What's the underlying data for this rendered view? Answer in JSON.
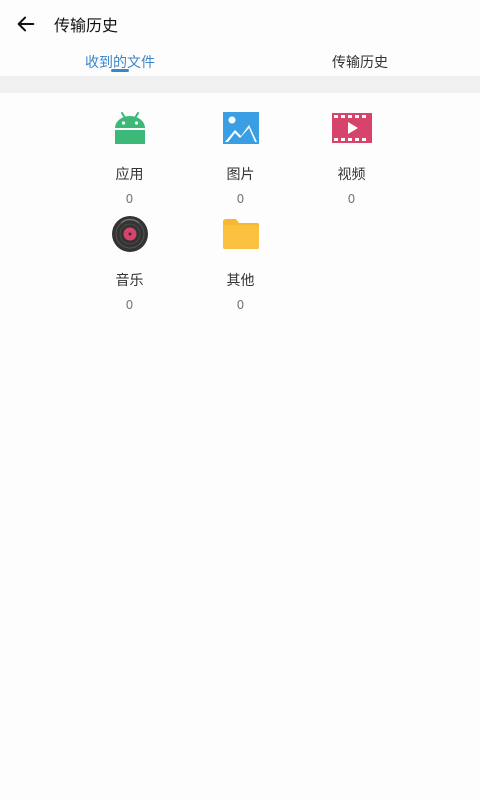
{
  "header": {
    "title": "传输历史"
  },
  "tabs": [
    {
      "label": "收到的文件",
      "active": true
    },
    {
      "label": "传输历史",
      "active": false
    }
  ],
  "categories": [
    {
      "label": "应用",
      "count": "0",
      "icon": "android-icon",
      "color": "#3cb878"
    },
    {
      "label": "图片",
      "count": "0",
      "icon": "image-icon",
      "color": "#3a9ee4"
    },
    {
      "label": "视频",
      "count": "0",
      "icon": "video-icon",
      "color": "#d6446b"
    },
    {
      "label": "音乐",
      "count": "0",
      "icon": "vinyl-record-icon",
      "color": "#333333"
    },
    {
      "label": "其他",
      "count": "0",
      "icon": "folder-icon",
      "color": "#f7b731"
    }
  ],
  "colors": {
    "accent": "#3a86c9",
    "band": "#f0f0f0"
  }
}
